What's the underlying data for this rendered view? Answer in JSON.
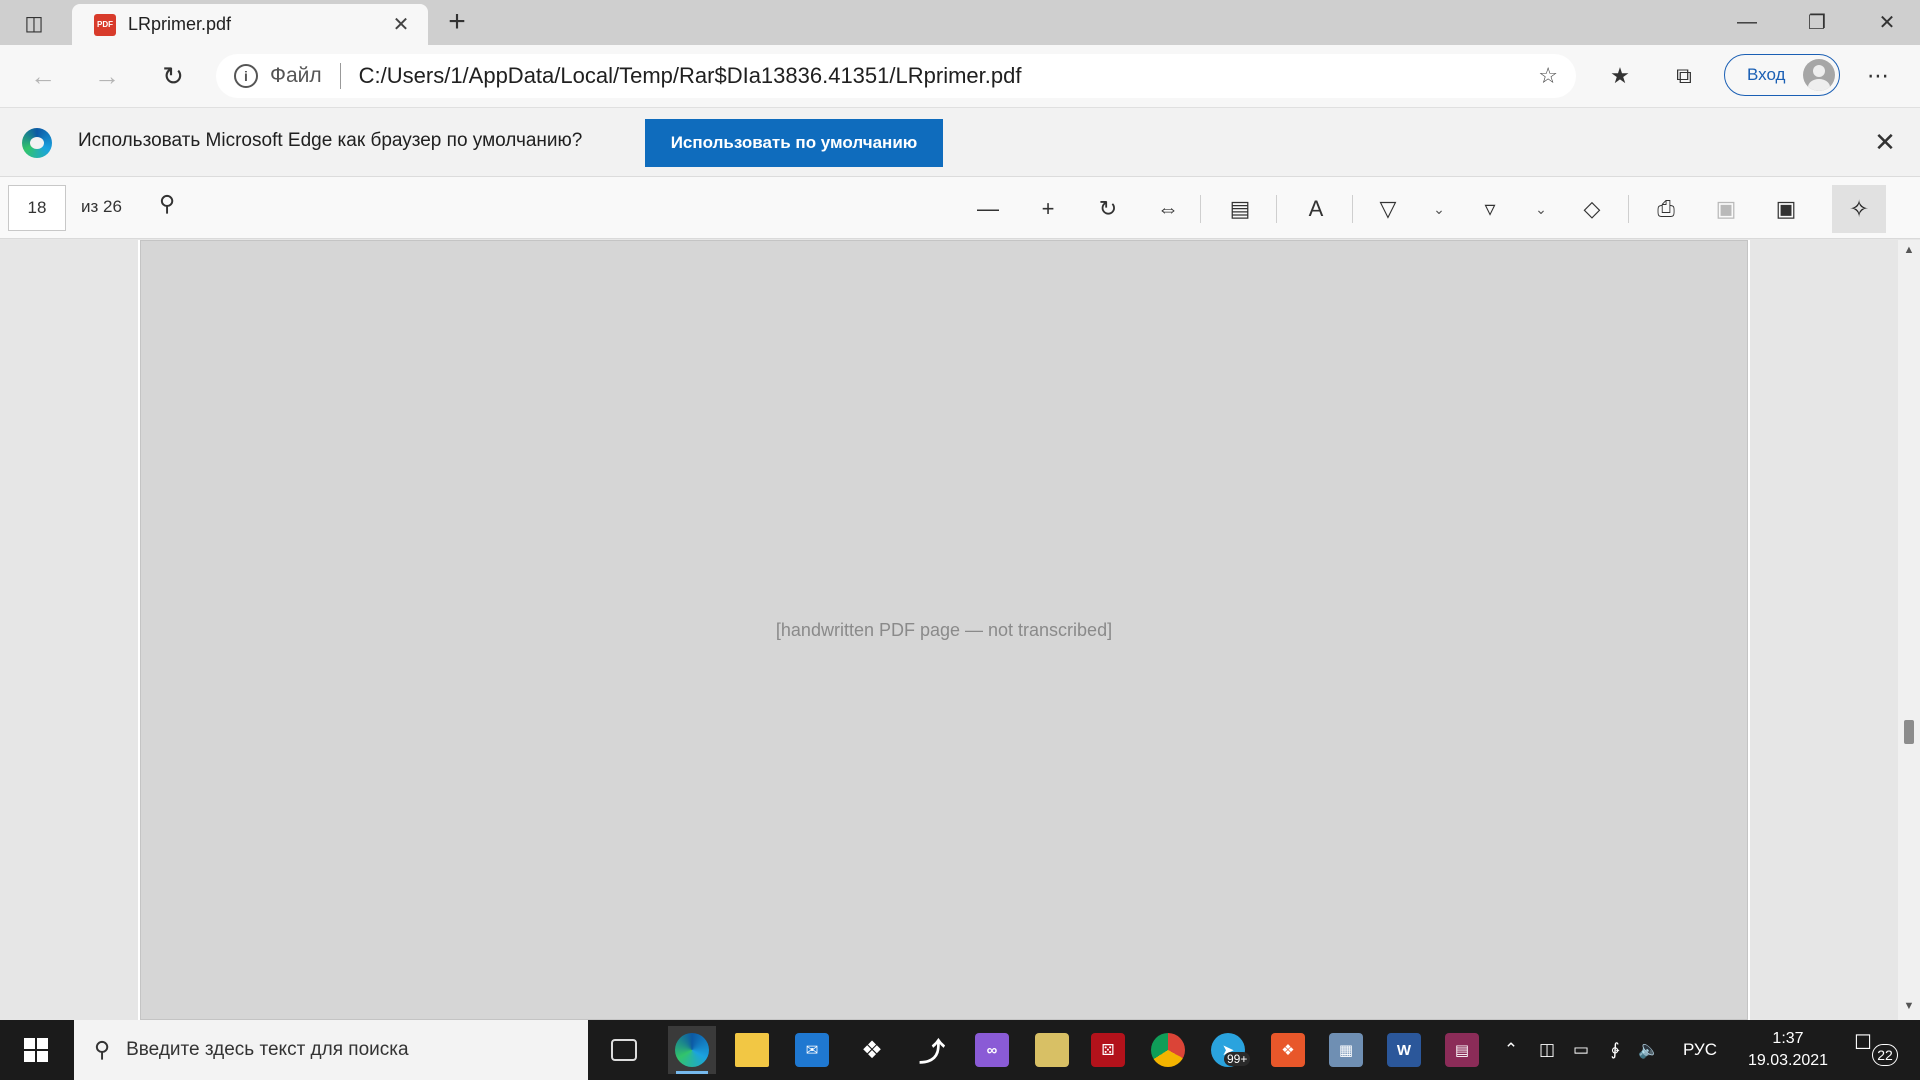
{
  "tab": {
    "title": "LRprimer.pdf"
  },
  "address": {
    "scheme_label": "Файл",
    "url": "C:/Users/1/AppData/Local/Temp/Rar$DIa13836.41351/LRprimer.pdf"
  },
  "profile": {
    "signin_label": "Вход"
  },
  "infobar": {
    "message": "Использовать Microsoft Edge как браузер по умолчанию?",
    "button_label": "Использовать по умолчанию"
  },
  "pdf_toolbar": {
    "page_current": "18",
    "page_total_label": "из 26"
  },
  "document": {
    "page_content": "[handwritten PDF page — not transcribed]"
  },
  "taskbar": {
    "search_placeholder": "Введите здесь текст для поиска",
    "mail_badge": "99+",
    "language": "РУС",
    "time": "1:37",
    "date": "19.03.2021",
    "notification_count": "22"
  },
  "icons": {
    "back": "arrow-left-icon",
    "forward": "arrow-right-icon",
    "refresh": "refresh-icon",
    "favorites_add": "star-plus-icon",
    "favorites": "favorites-icon",
    "collections": "collections-icon",
    "more": "more-icon",
    "pdf_search": "search-icon",
    "zoom_out": "minus-icon",
    "zoom_in": "plus-icon",
    "rotate": "rotate-icon",
    "fit": "fit-width-icon",
    "page_view": "page-view-icon",
    "read_aloud": "read-aloud-icon",
    "draw": "draw-icon",
    "highlight": "highlight-icon",
    "erase": "eraser-icon",
    "print": "print-icon",
    "save": "save-icon",
    "save_as": "save-as-icon",
    "pin": "pin-icon"
  },
  "colors": {
    "accent": "#0f6cbd",
    "taskbar": "#1b1b1b",
    "titlebar": "#cfcfcf"
  }
}
